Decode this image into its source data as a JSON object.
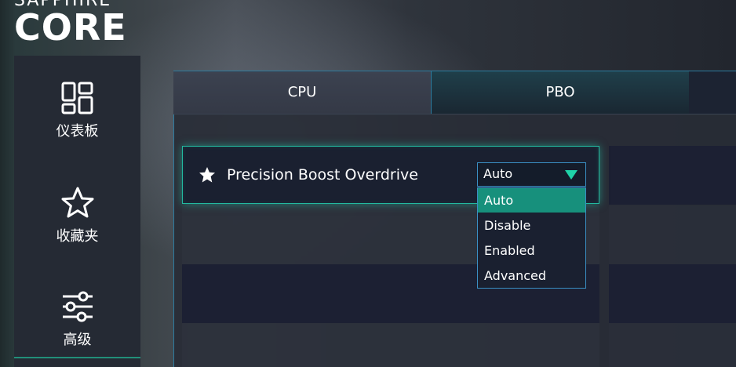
{
  "brand": {
    "top": "SAPPHIRE",
    "core": "CORE"
  },
  "sidebar": {
    "items": [
      {
        "label": "仪表板",
        "icon": "dashboard-icon"
      },
      {
        "label": "收藏夹",
        "icon": "star-outline-icon"
      },
      {
        "label": "高级",
        "icon": "sliders-icon"
      }
    ]
  },
  "tabs": [
    {
      "label": "CPU"
    },
    {
      "label": "PBO",
      "active": true
    },
    {
      "label": ""
    }
  ],
  "setting": {
    "label": "Precision Boost Overdrive",
    "icon": "star-filled-icon",
    "value": "Auto",
    "options": [
      "Auto",
      "Disable",
      "Enabled",
      "Advanced"
    ],
    "selected_option": "Auto"
  },
  "colors": {
    "accent": "#1fd3a8",
    "selected_option": "#17907c",
    "border": "#3a8fc4"
  }
}
